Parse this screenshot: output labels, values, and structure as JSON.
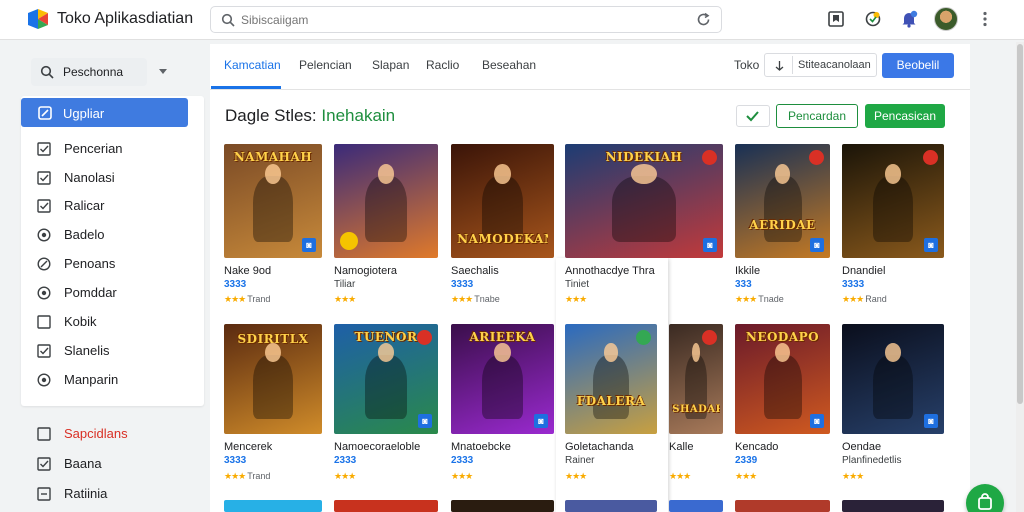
{
  "app": {
    "title": "Toko Aplikasdiatian"
  },
  "search": {
    "placeholder": "Sibiscaiigam"
  },
  "sidebar": {
    "dropdown_label": "Peschonna",
    "items": [
      {
        "label": "Ugpliar",
        "icon": "edit-square-icon",
        "active": true
      },
      {
        "label": "Pencerian",
        "icon": "checkbox-checked-icon"
      },
      {
        "label": "Nanolasi",
        "icon": "checkbox-checked-icon"
      },
      {
        "label": "Ralicar",
        "icon": "checkbox-checked-icon"
      },
      {
        "label": "Badelo",
        "icon": "radio-icon"
      },
      {
        "label": "Penoans",
        "icon": "slash-circle-icon"
      },
      {
        "label": "Pomddar",
        "icon": "radio-icon"
      },
      {
        "label": "Kobik",
        "icon": "checkbox-empty-icon"
      },
      {
        "label": "Slanelis",
        "icon": "checkbox-checked-icon"
      },
      {
        "label": "Manparin",
        "icon": "radio-icon"
      }
    ],
    "extra_items": [
      {
        "label": "Sapcidlans",
        "icon": "checkbox-empty-icon",
        "color": "#d93025"
      },
      {
        "label": "Baana",
        "icon": "checkbox-checked-icon"
      },
      {
        "label": "Ratiinia",
        "icon": "checkbox-dash-icon"
      }
    ]
  },
  "tabs": [
    "Kamcatian",
    "Pelencian",
    "Slapan",
    "Raclio",
    "Beseahan"
  ],
  "toolbar": {
    "toko_label": "Toko",
    "filter_label": "Stiteacanolaan",
    "primary_button": "Beobelil"
  },
  "section": {
    "title_prefix": "Dagle Stles:",
    "title_accent": "Inehakain",
    "outline_button": "Pencardan",
    "green_button": "Pencasican"
  },
  "cards": [
    {
      "name": "Nake 9od",
      "price": "3333",
      "rating_stars": "★★★",
      "rating_text": "Trand",
      "banner": "NAMAHAH",
      "colors": [
        "#7a4a26",
        "#c88a3a"
      ]
    },
    {
      "name": "Namogiotera",
      "sub": "Tiliar",
      "rating_stars": "★★★",
      "colors": [
        "#3a2a7a",
        "#e07a2a"
      ]
    },
    {
      "name": "Saechalis",
      "price": "3333",
      "rating_stars": "★★★",
      "rating_text": "Tnabe",
      "banner": "NAMODEKAN",
      "colors": [
        "#3a1408",
        "#a8561c"
      ]
    },
    {
      "name": "Annothacdye Thra",
      "sub": "Tiniet",
      "rating_stars": "★★★",
      "banner": "NIDEKIAH",
      "colors": [
        "#1c3c74",
        "#c33a3a"
      ]
    },
    {
      "name": "Ikkile",
      "price": "333",
      "rating_stars": "★★★",
      "rating_text": "Tnade",
      "banner": "AERIDAE",
      "colors": [
        "#183055",
        "#c57a23"
      ]
    },
    {
      "name": "Dnandiel",
      "price": "3333",
      "rating_stars": "★★★",
      "rating_text": "Rand",
      "colors": [
        "#1a1408",
        "#8b5a1c"
      ]
    },
    {
      "name": "Mencerek",
      "price": "3333",
      "rating_stars": "★★★",
      "rating_text": "Trand",
      "banner": "SDIRITLX",
      "colors": [
        "#5a2a10",
        "#d08c2a"
      ]
    },
    {
      "name": "Namoecoraeloble",
      "price": "2333",
      "rating_stars": "★★★",
      "banner": "TUENOR",
      "colors": [
        "#1e5fa8",
        "#2a8a4a"
      ]
    },
    {
      "name": "Mnatoebcke",
      "price": "2333",
      "rating_stars": "★★★",
      "banner": "ARIEEKA",
      "colors": [
        "#3a0e4a",
        "#9a2ad0"
      ]
    },
    {
      "name": "Goletachanda",
      "sub": "Rainer",
      "rating_stars": "★★★",
      "banner": "FDALERA",
      "colors": [
        "#2a6ac0",
        "#c8a040"
      ]
    },
    {
      "name": "Kalle",
      "price": "",
      "rating_stars": "★★★",
      "banner": "SHADAR",
      "colors": [
        "#3a2a22",
        "#a87a5a"
      ]
    },
    {
      "name": "Kencado",
      "price": "2339",
      "rating_stars": "★★★",
      "banner": "NEODAPO",
      "colors": [
        "#6a1a2a",
        "#d05a20"
      ]
    },
    {
      "name": "Oendae",
      "sub": "Planfinedetlis",
      "rating_stars": "★★★",
      "colors": [
        "#0a0e1c",
        "#27406a"
      ]
    }
  ]
}
